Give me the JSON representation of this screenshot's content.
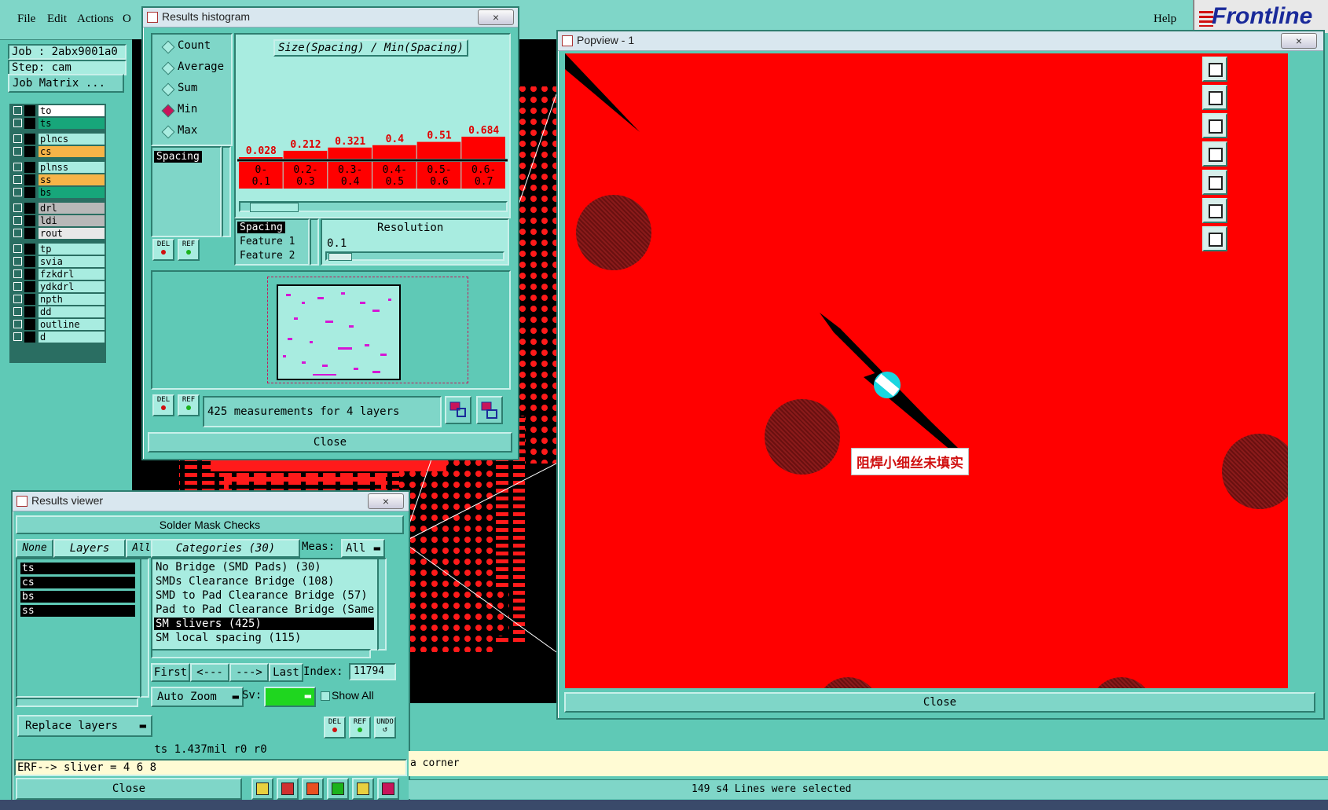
{
  "menubar": {
    "items": [
      "File",
      "Edit",
      "Actions",
      "O"
    ],
    "help": "Help",
    "brand": "Frontline"
  },
  "job": {
    "job_label": "Job : 2abx9001a0",
    "step_label": "Step: cam",
    "matrix_button": "Job Matrix ..."
  },
  "layers": [
    {
      "name": "to",
      "color": "#ffffff"
    },
    {
      "name": "ts",
      "color": "#17a67a"
    },
    {
      "name": "plncs",
      "color": "#a8ece0"
    },
    {
      "name": "cs",
      "color": "#f6b448"
    },
    {
      "name": "plnss",
      "color": "#a8ece0"
    },
    {
      "name": "ss",
      "color": "#f6b448"
    },
    {
      "name": "bs",
      "color": "#17a67a"
    },
    {
      "name": "drl",
      "color": "#b8b8b8"
    },
    {
      "name": "ldi",
      "color": "#b8b8b8"
    },
    {
      "name": "rout",
      "color": "#e8e8e8"
    },
    {
      "name": "tp",
      "color": "#a8ece0"
    },
    {
      "name": "svia",
      "color": "#a8ece0"
    },
    {
      "name": "fzkdrl",
      "color": "#a8ece0"
    },
    {
      "name": "ydkdrl",
      "color": "#a8ece0"
    },
    {
      "name": "npth",
      "color": "#a8ece0"
    },
    {
      "name": "dd",
      "color": "#a8ece0"
    },
    {
      "name": "outline",
      "color": "#a8ece0"
    },
    {
      "name": "d",
      "color": "#a8ece0"
    }
  ],
  "histogram": {
    "title": "Results histogram",
    "close_x": "×",
    "modes": [
      "Count",
      "Average",
      "Sum",
      "Min",
      "Max"
    ],
    "selected_mode": "Min",
    "axis_title": "Size(Spacing) / Min(Spacing)",
    "left_list": [
      "Spacing"
    ],
    "measure_list": [
      "Spacing",
      "Feature 1",
      "Feature 2"
    ],
    "resolution_label": "Resolution",
    "resolution_value": "0.1",
    "summary": "425 measurements for 4 layers",
    "close": "Close",
    "del": "DEL",
    "ref": "REF"
  },
  "chart_data": {
    "type": "bar",
    "title": "Size(Spacing) / Min(Spacing)",
    "categories": [
      "0-0.1",
      "0.2-0.3",
      "0.3-0.4",
      "0.4-0.5",
      "0.5-0.6",
      "0.6-0.7"
    ],
    "values": [
      0.028,
      0.212,
      0.321,
      0.4,
      0.51,
      0.684
    ],
    "value_labels": [
      "0.028",
      "0.212",
      "0.321",
      "0.4",
      "0.51",
      "0.684"
    ],
    "bin_top": [
      "0-",
      "0.2-",
      "0.3-",
      "0.4-",
      "0.5-",
      "0.6-"
    ],
    "bin_bottom": [
      "0.1",
      "0.3",
      "0.4",
      "0.5",
      "0.6",
      "0.7"
    ],
    "ylim": [
      0,
      0.7
    ],
    "color": "#ff0000"
  },
  "popview": {
    "title": "Popview - 1",
    "close_x": "×",
    "annotation": "阻焊小细丝未填实",
    "close": "Close"
  },
  "viewer": {
    "title": "Results viewer",
    "close_x": "×",
    "heading": "Solder Mask Checks",
    "none": "None",
    "layers": "Layers",
    "all": "All",
    "categories_button": "Categories (30)",
    "meas_label": "Meas:",
    "meas_value": "All",
    "layer_items": [
      "ts",
      "cs",
      "bs",
      "ss"
    ],
    "category_items": [
      "No Bridge (SMD Pads) (30)",
      "SMDs Clearance Bridge (108)",
      "SMD to Pad Clearance Bridge (57)",
      "Pad to Pad Clearance Bridge (Same",
      "SM slivers (425)",
      "SM local spacing (115)"
    ],
    "selected_category": 4,
    "first": "First",
    "prev": "<---",
    "next": "--->",
    "last": "Last",
    "index_label": "Index:",
    "index_value": "11794",
    "auto_zoom": "Auto Zoom",
    "sv_label": "Sv:",
    "show_all": "Show All",
    "replace_layers": "Replace layers",
    "undo": "UNDO",
    "info": "ts 1.437mil  r0  r0",
    "erf": "ERF--> sliver = 4 6 8",
    "close": "Close"
  },
  "statusbar": {
    "message_tail": "a corner",
    "selection": "149 s4 Lines were selected"
  }
}
